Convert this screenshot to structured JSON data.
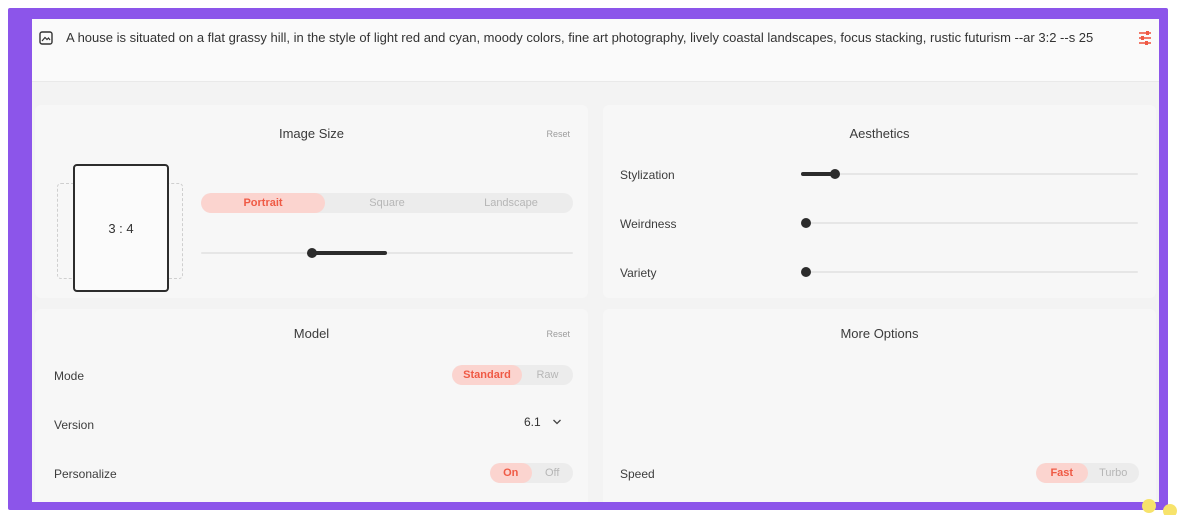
{
  "prompt": {
    "text": "A house is situated on a flat grassy hill, in the style of light red and cyan, moody colors, fine art photography, lively coastal landscapes, focus stacking, rustic futurism --ar 3:2 --s 25",
    "icon": "image-icon",
    "settings_icon": "sliders-icon"
  },
  "image_size": {
    "title": "Image Size",
    "reset": "Reset",
    "ratio": "3 : 4",
    "orientations": [
      "Portrait",
      "Square",
      "Landscape"
    ],
    "selected": "Portrait"
  },
  "aesthetics": {
    "title": "Aesthetics",
    "sliders": [
      {
        "label": "Stylization",
        "level": 0.1
      },
      {
        "label": "Weirdness",
        "level": 0
      },
      {
        "label": "Variety",
        "level": 0
      }
    ]
  },
  "model": {
    "title": "Model",
    "reset": "Reset",
    "mode": {
      "label": "Mode",
      "options": [
        "Standard",
        "Raw"
      ],
      "selected": "Standard"
    },
    "version": {
      "label": "Version",
      "value": "6.1"
    },
    "personalize": {
      "label": "Personalize",
      "options": [
        "On",
        "Off"
      ],
      "selected": "On"
    }
  },
  "more_options": {
    "title": "More Options",
    "speed": {
      "label": "Speed",
      "options": [
        "Fast",
        "Turbo"
      ],
      "selected": "Fast"
    }
  },
  "colors": {
    "frame": "#8c55ea",
    "accent": "#ef5a45",
    "accent_bg": "#fbd4cf",
    "dots": "#f7e36b"
  }
}
